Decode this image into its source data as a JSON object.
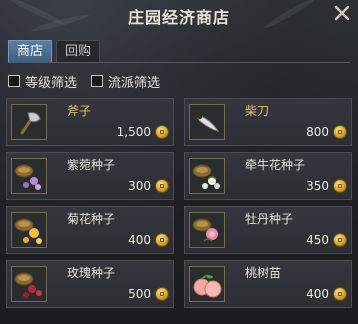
{
  "window": {
    "title": "庄园经济商店"
  },
  "tabs": [
    {
      "label": "商店",
      "active": true
    },
    {
      "label": "回购",
      "active": false
    }
  ],
  "filters": [
    {
      "label": "等级筛选",
      "checked": false
    },
    {
      "label": "流派筛选",
      "checked": false
    }
  ],
  "currency_icon": "coin-icon",
  "items": [
    {
      "name": "斧子",
      "price": "1,500",
      "icon": "axe-icon",
      "highlight": true
    },
    {
      "name": "柴刀",
      "price": "800",
      "icon": "machete-icon",
      "highlight": true
    },
    {
      "name": "紫菀种子",
      "price": "300",
      "icon": "aster-seed-icon",
      "highlight": false
    },
    {
      "name": "牵牛花种子",
      "price": "350",
      "icon": "morning-glory-seed-icon",
      "highlight": false
    },
    {
      "name": "菊花种子",
      "price": "400",
      "icon": "chrysanthemum-seed-icon",
      "highlight": false
    },
    {
      "name": "牡丹种子",
      "price": "450",
      "icon": "peony-seed-icon",
      "highlight": false
    },
    {
      "name": "玫瑰种子",
      "price": "500",
      "icon": "rose-seed-icon",
      "highlight": false
    },
    {
      "name": "桃树苗",
      "price": "400",
      "icon": "peach-sapling-icon",
      "highlight": false
    }
  ]
}
